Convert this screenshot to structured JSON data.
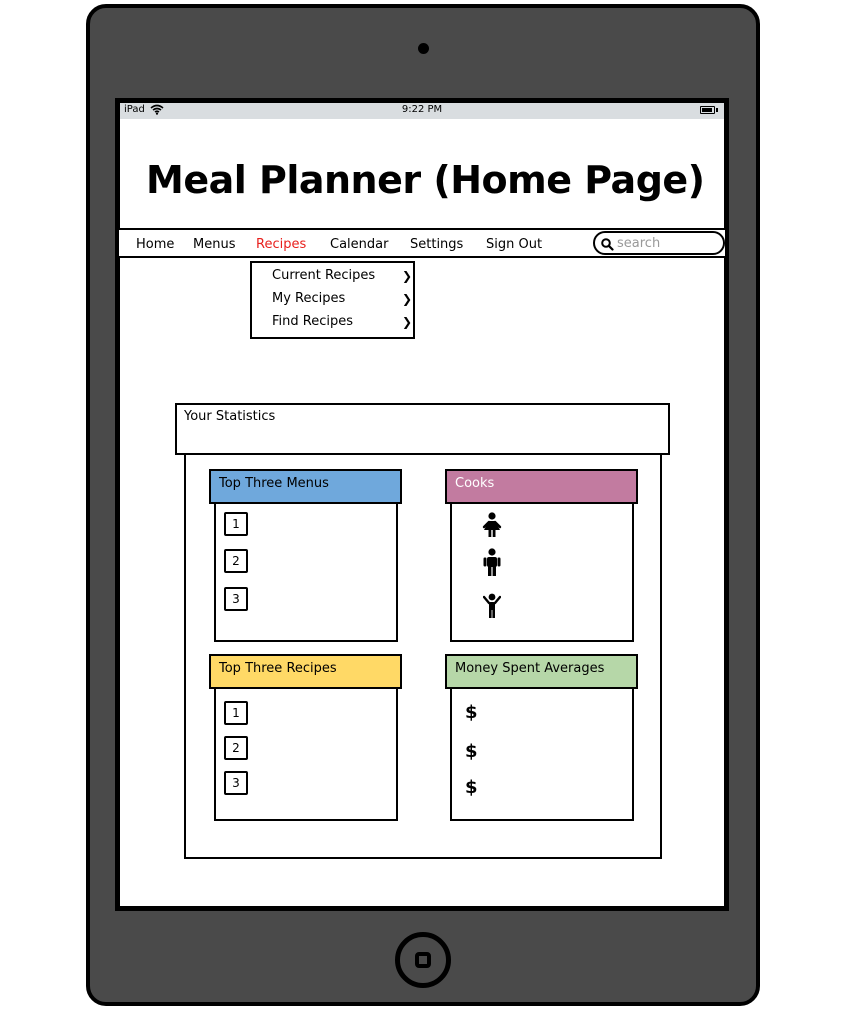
{
  "status_bar": {
    "carrier": "iPad",
    "time": "9:22 PM"
  },
  "title": "Meal Planner (Home Page)",
  "nav": {
    "items": [
      {
        "label": "Home",
        "active": false
      },
      {
        "label": "Menus",
        "active": false
      },
      {
        "label": "Recipes",
        "active": true
      },
      {
        "label": "Calendar",
        "active": false
      },
      {
        "label": "Settings",
        "active": false
      },
      {
        "label": "Sign Out",
        "active": false
      }
    ],
    "search_placeholder": "search"
  },
  "dropdown": {
    "items": [
      {
        "label": "Current Recipes",
        "arrow": "❯"
      },
      {
        "label": "My Recipes",
        "arrow": "❯"
      },
      {
        "label": "Find Recipes",
        "arrow": "❯"
      }
    ]
  },
  "statistics": {
    "title": "Your Statistics",
    "top_menus": {
      "title": "Top Three Menus",
      "color": "#6fa8dc",
      "ranks": [
        "1",
        "2",
        "3"
      ]
    },
    "cooks": {
      "title": "Cooks",
      "color": "#c27ba0",
      "icons": [
        "woman-icon",
        "man-icon",
        "child-icon"
      ]
    },
    "top_recipes": {
      "title": "Top Three Recipes",
      "color": "#ffd966",
      "ranks": [
        "1",
        "2",
        "3"
      ]
    },
    "money": {
      "title": "Money Spent Averages",
      "color": "#b6d7a8",
      "symbols": [
        "$",
        "$",
        "$"
      ]
    }
  }
}
